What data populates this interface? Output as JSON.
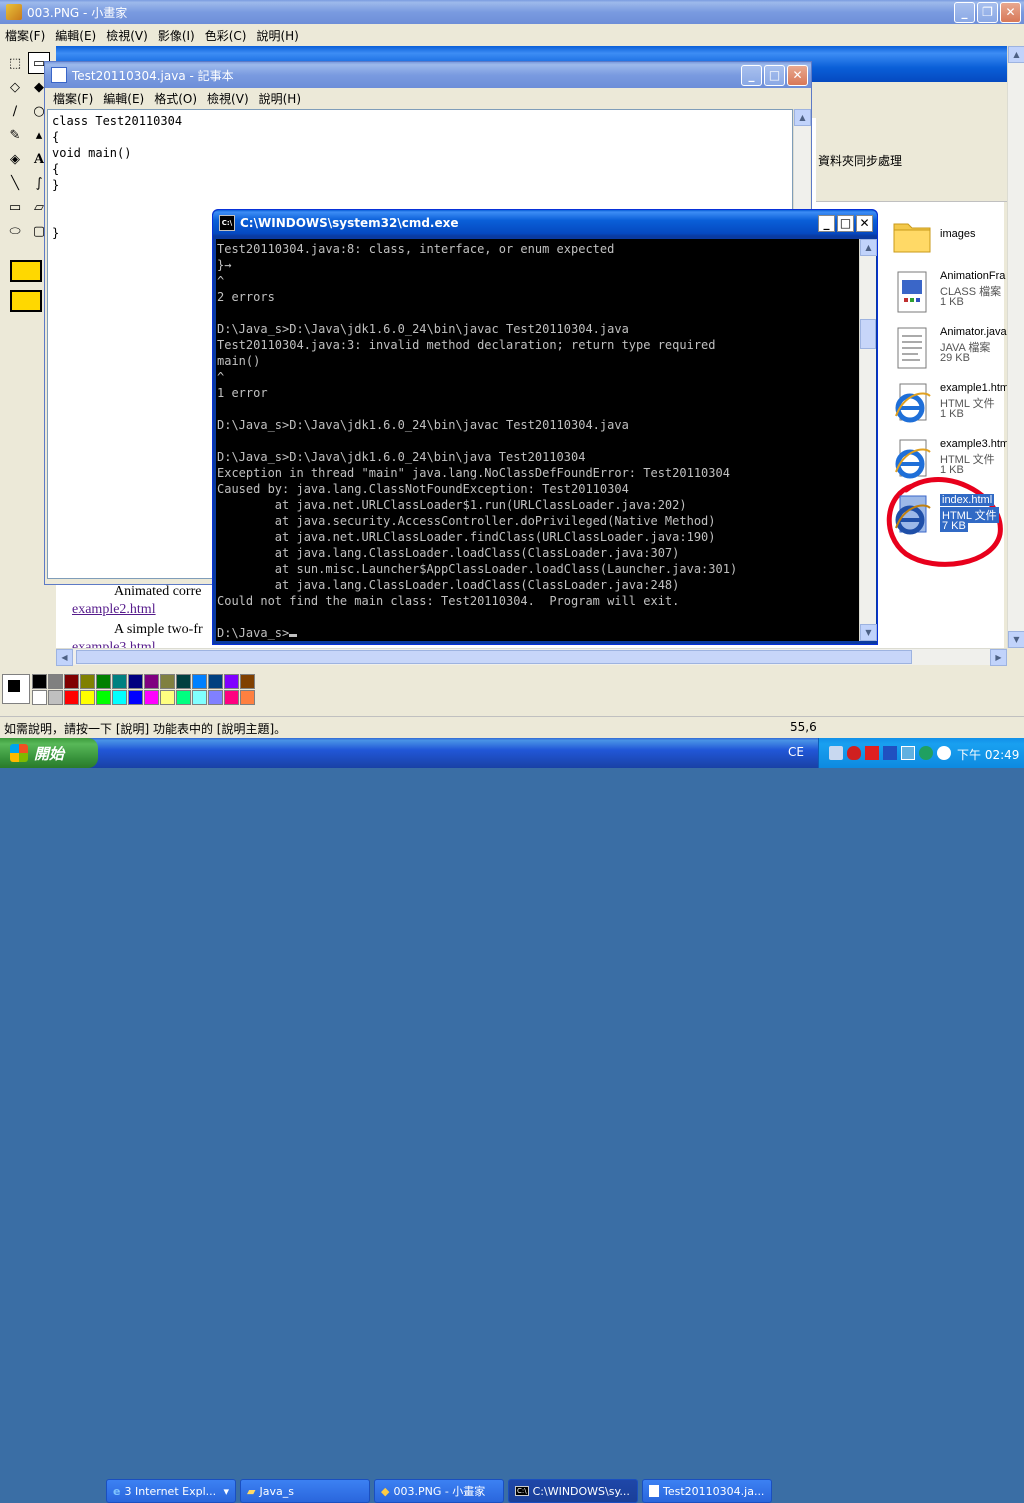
{
  "paint": {
    "title": "003.PNG - 小畫家",
    "menu": [
      "檔案(F)",
      "編輯(E)",
      "檢視(V)",
      "影像(I)",
      "色彩(C)",
      "說明(H)"
    ],
    "status_help": "如需說明，請按一下 [說明] 功能表中的 [說明主題]。",
    "status_coords": "55,6",
    "palette": [
      "#000000",
      "#808080",
      "#800000",
      "#808000",
      "#008000",
      "#008080",
      "#000080",
      "#800080",
      "#808040",
      "#004040",
      "#0080ff",
      "#004080",
      "#8000ff",
      "#804000",
      "#ffffff",
      "#c0c0c0",
      "#ff0000",
      "#ffff00",
      "#00ff00",
      "#00ffff",
      "#0000ff",
      "#ff00ff",
      "#ffff80",
      "#00ff80",
      "#80ffff",
      "#8080ff",
      "#ff0080",
      "#ff8040"
    ]
  },
  "explorer": {
    "sync_label": "資料夾同步處理",
    "files": [
      {
        "name": "images",
        "type": "",
        "size": "",
        "icon": "folder-icon"
      },
      {
        "name": "AnimationFra",
        "type": "CLASS 檔案",
        "size": "1 KB",
        "icon": "class-file-icon"
      },
      {
        "name": "Animator.java",
        "type": "JAVA 檔案",
        "size": "29 KB",
        "icon": "java-file-icon"
      },
      {
        "name": "example1.htm",
        "type": "HTML 文件",
        "size": "1 KB",
        "icon": "ie-html-icon"
      },
      {
        "name": "example3.htm",
        "type": "HTML 文件",
        "size": "1 KB",
        "icon": "ie-html-icon"
      },
      {
        "name": "index.html",
        "type": "HTML 文件",
        "size": "7 KB",
        "icon": "ie-html-icon"
      }
    ]
  },
  "webpage": {
    "line1": "Animated corre",
    "link1": "example2.html",
    "line2": "A simple two-fr",
    "link2": "example3.html"
  },
  "notepad": {
    "title": "Test20110304.java - 記事本",
    "menu": [
      "檔案(F)",
      "編輯(E)",
      "格式(O)",
      "檢視(V)",
      "說明(H)"
    ],
    "lines": [
      "class Test20110304",
      "{",
      "void main()",
      "{",
      "}",
      "",
      "",
      "}"
    ]
  },
  "cmd": {
    "title": "C:\\WINDOWS\\system32\\cmd.exe",
    "lines": [
      "Test20110304.java:8: class, interface, or enum expected",
      "}→",
      "^",
      "2 errors",
      "",
      "D:\\Java_s>D:\\Java\\jdk1.6.0_24\\bin\\javac Test20110304.java",
      "Test20110304.java:3: invalid method declaration; return type required",
      "main()",
      "^",
      "1 error",
      "",
      "D:\\Java_s>D:\\Java\\jdk1.6.0_24\\bin\\javac Test20110304.java",
      "",
      "D:\\Java_s>D:\\Java\\jdk1.6.0_24\\bin\\java Test20110304",
      "Exception in thread \"main\" java.lang.NoClassDefFoundError: Test20110304",
      "Caused by: java.lang.ClassNotFoundException: Test20110304",
      "        at java.net.URLClassLoader$1.run(URLClassLoader.java:202)",
      "        at java.security.AccessController.doPrivileged(Native Method)",
      "        at java.net.URLClassLoader.findClass(URLClassLoader.java:190)",
      "        at java.lang.ClassLoader.loadClass(ClassLoader.java:307)",
      "        at sun.misc.Launcher$AppClassLoader.loadClass(Launcher.java:301)",
      "        at java.lang.ClassLoader.loadClass(ClassLoader.java:248)",
      "Could not find the main class: Test20110304.  Program will exit.",
      "",
      "D:\\Java_s>"
    ]
  },
  "taskbar": {
    "start": "開始",
    "tasks": [
      "3 Internet Expl...",
      "Java_s",
      "003.PNG - 小畫家",
      "C:\\WINDOWS\\sy...",
      "Test20110304.ja..."
    ],
    "lang": "CE",
    "clock": "下午 02:49"
  }
}
